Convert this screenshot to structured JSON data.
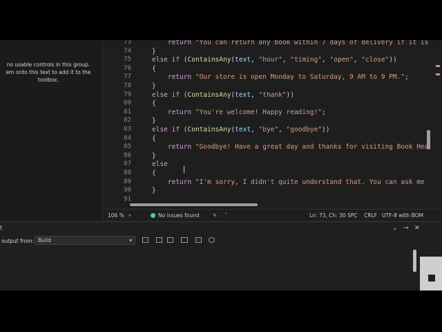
{
  "toolbox": {
    "message_lines": [
      "no usable controls in this group.",
      "em onto this text to add it to the",
      "toolbox."
    ]
  },
  "editor": {
    "lines": [
      {
        "num": "73",
        "code": [
          [
            "kw",
            "    return "
          ],
          [
            "str",
            "\"You can return any book within 7 days of delivery if it is"
          ]
        ]
      },
      {
        "num": "74",
        "code": [
          [
            "",
            "}"
          ]
        ]
      },
      {
        "num": "75",
        "code": [
          [
            "kw",
            "else if"
          ],
          [
            "",
            " ("
          ],
          [
            "fn",
            "ContainsAny"
          ],
          [
            "",
            "("
          ],
          [
            "id",
            "text"
          ],
          [
            "",
            ", "
          ],
          [
            "str",
            "\"hour\""
          ],
          [
            "",
            ", "
          ],
          [
            "str",
            "\"timing\""
          ],
          [
            "",
            ", "
          ],
          [
            "str",
            "\"open\""
          ],
          [
            "",
            ", "
          ],
          [
            "str",
            "\"close\""
          ],
          [
            "",
            "))"
          ]
        ]
      },
      {
        "num": "76",
        "code": [
          [
            "",
            "{"
          ]
        ]
      },
      {
        "num": "77",
        "code": [
          [
            "kw",
            "    return "
          ],
          [
            "str",
            "\"Our store is open Monday to Saturday, 9 AM to 9 PM.\""
          ],
          [
            "",
            ";"
          ]
        ]
      },
      {
        "num": "78",
        "code": [
          [
            "",
            "}"
          ]
        ]
      },
      {
        "num": "79",
        "code": [
          [
            "kw",
            "else if"
          ],
          [
            "",
            " ("
          ],
          [
            "fn",
            "ContainsAny"
          ],
          [
            "",
            "("
          ],
          [
            "id",
            "text"
          ],
          [
            "",
            ", "
          ],
          [
            "str",
            "\"thank\""
          ],
          [
            "",
            "))"
          ]
        ]
      },
      {
        "num": "80",
        "code": [
          [
            "",
            "{"
          ]
        ]
      },
      {
        "num": "81",
        "code": [
          [
            "kw",
            "    return "
          ],
          [
            "str",
            "\"You're welcome! Happy reading!\""
          ],
          [
            "",
            ";"
          ]
        ]
      },
      {
        "num": "82",
        "code": [
          [
            "",
            "}"
          ]
        ]
      },
      {
        "num": "83",
        "code": [
          [
            "kw",
            "else if"
          ],
          [
            "",
            " ("
          ],
          [
            "fn",
            "ContainsAny"
          ],
          [
            "",
            "("
          ],
          [
            "id",
            "text"
          ],
          [
            "",
            ", "
          ],
          [
            "str",
            "\"bye\""
          ],
          [
            "",
            ", "
          ],
          [
            "str",
            "\"goodbye\""
          ],
          [
            "",
            "))"
          ]
        ]
      },
      {
        "num": "84",
        "code": [
          [
            "",
            "{"
          ]
        ]
      },
      {
        "num": "85",
        "code": [
          [
            "kw",
            "    return "
          ],
          [
            "str",
            "\"Goodbye! Have a great day and thanks for visiting Book Hea"
          ]
        ]
      },
      {
        "num": "86",
        "code": [
          [
            "",
            "}"
          ]
        ]
      },
      {
        "num": "87",
        "code": [
          [
            "kw",
            "else"
          ]
        ]
      },
      {
        "num": "88",
        "code": [
          [
            "",
            "{"
          ]
        ]
      },
      {
        "num": "89",
        "code": [
          [
            "kw",
            "    return "
          ],
          [
            "str",
            "\"I'm sorry, I didn't quite understand that. You can ask me"
          ]
        ]
      },
      {
        "num": "90",
        "code": [
          [
            "",
            "}"
          ]
        ]
      },
      {
        "num": "91",
        "code": [
          [
            "",
            ""
          ]
        ]
      }
    ]
  },
  "statusbar": {
    "zoom": "106 %",
    "issues": "No issues found",
    "position": "Ln: 73, Ch: 30",
    "indent": "SPC",
    "line_ending": "CRLF",
    "encoding": "UTF-8 with BOM"
  },
  "output": {
    "title": "t",
    "show_from_label": "output from:",
    "source": "Build"
  }
}
